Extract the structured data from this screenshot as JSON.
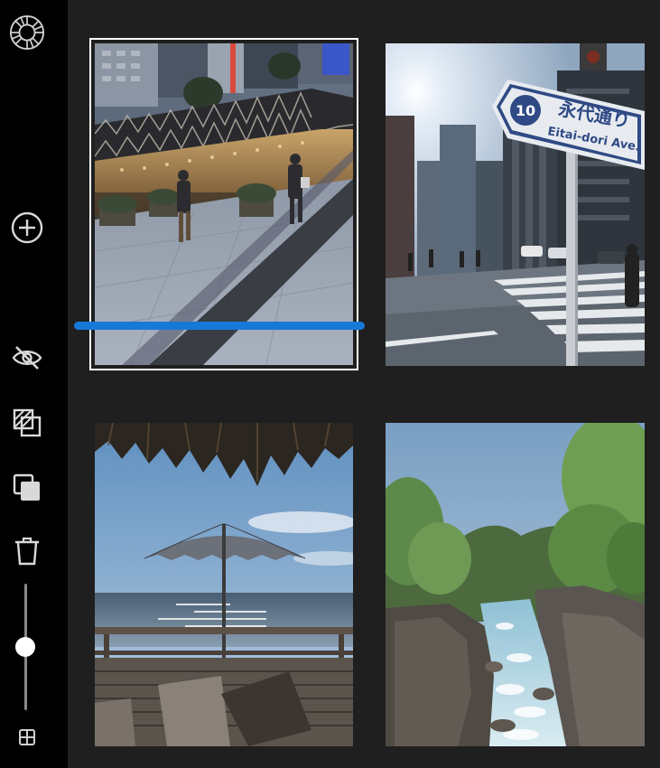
{
  "app": {
    "sidebar_icons": [
      "app-logo-icon",
      "add-photo-icon",
      "hide-icon",
      "toggle-overlay-icon",
      "duplicate-icon",
      "delete-icon",
      "grid-view-icon"
    ],
    "zoom_slider": {
      "value": 0.5
    }
  },
  "photos": [
    {
      "id": "photo-1",
      "subject": "evening storefront with pedestrians on tiled sidewalk",
      "selected": true,
      "sign": "",
      "sign_subtitle": ""
    },
    {
      "id": "photo-2",
      "subject": "city street with crosswalk and road sign",
      "selected": false,
      "sign": "永代通り",
      "sign_subtitle": "Eitai-dori Ave.",
      "sign_number": "10"
    },
    {
      "id": "photo-3",
      "subject": "seaside deck with umbrella under thatched roof",
      "selected": false
    },
    {
      "id": "photo-4",
      "subject": "mountain river gorge with green trees",
      "selected": false
    }
  ],
  "colors": {
    "accent": "#1679d8",
    "sidebar": "#000000",
    "background": "#1f1f1f"
  }
}
